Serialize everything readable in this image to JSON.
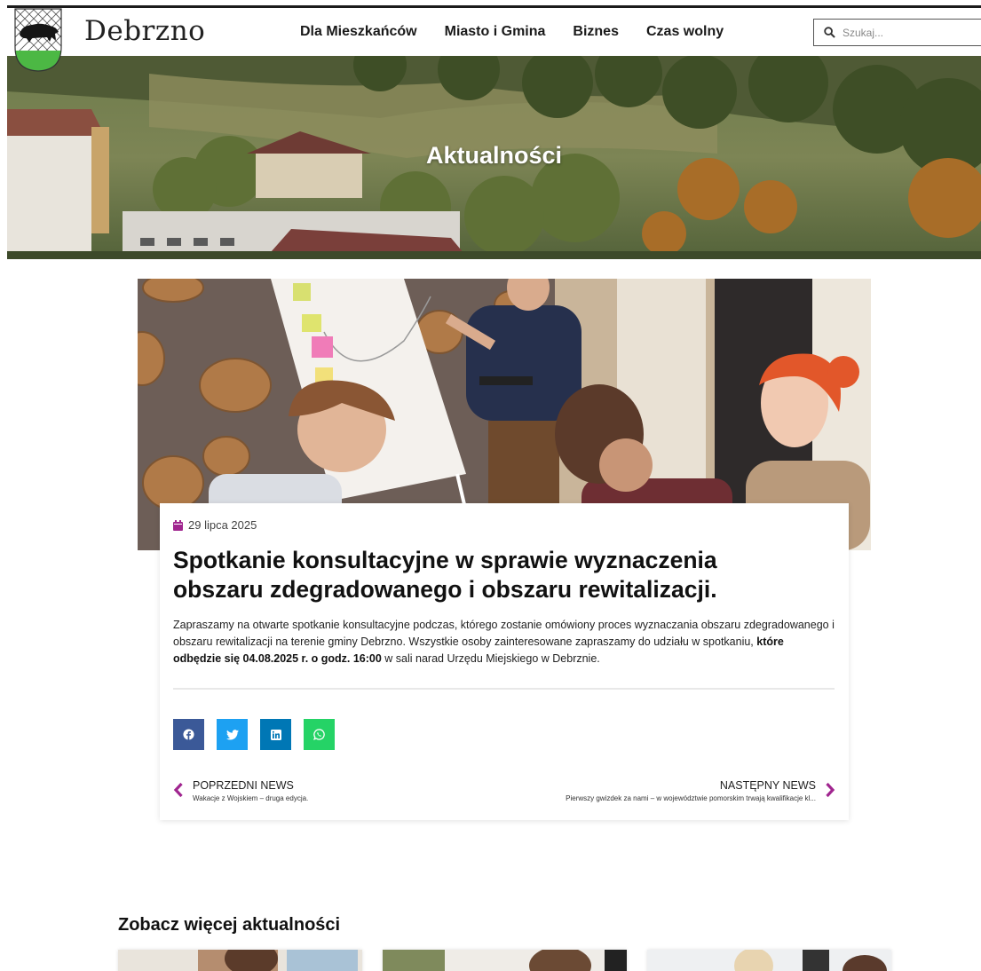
{
  "header": {
    "logo_text": "Debrzno",
    "nav": [
      "Dla Mieszkańców",
      "Miasto i Gmina",
      "Biznes",
      "Czas wolny"
    ],
    "search_placeholder": "Szukaj..."
  },
  "hero": {
    "title": "Aktualności"
  },
  "article": {
    "date": "29 lipca 2025",
    "title": "Spotkanie konsultacyjne w sprawie wyznaczenia obszaru zdegradowanego i obszaru rewitalizacji.",
    "body_part1": "Zapraszamy na otwarte spotkanie konsultacyjne podczas, którego zostanie omówiony proces wyznaczania obszaru zdegradowanego i obszaru rewitalizacji na terenie gminy Debrzno. Wszystkie osoby zainteresowane zapraszamy do udziału w spotkaniu, ",
    "body_bold": "które odbędzie się 04.08.2025 r. o godz. 16:00",
    "body_part2": " w sali narad Urzędu Miejskiego w Debrznie.",
    "share": [
      "facebook-icon",
      "twitter-icon",
      "linkedin-icon",
      "whatsapp-icon"
    ]
  },
  "pagination": {
    "prev_label": "POPRZEDNI NEWS",
    "prev_title": "Wakacje z Wojskiem – druga edycja.",
    "next_label": "NASTĘPNY NEWS",
    "next_title": "Pierwszy gwizdek za nami – w województwie pomorskim trwają kwalifikacje kl..."
  },
  "more": {
    "title": "Zobacz więcej aktualności"
  },
  "colors": {
    "accent": "#a0258f",
    "facebook": "#3b5998",
    "twitter": "#1da1f2",
    "linkedin": "#0077b5",
    "whatsapp": "#25d366"
  }
}
